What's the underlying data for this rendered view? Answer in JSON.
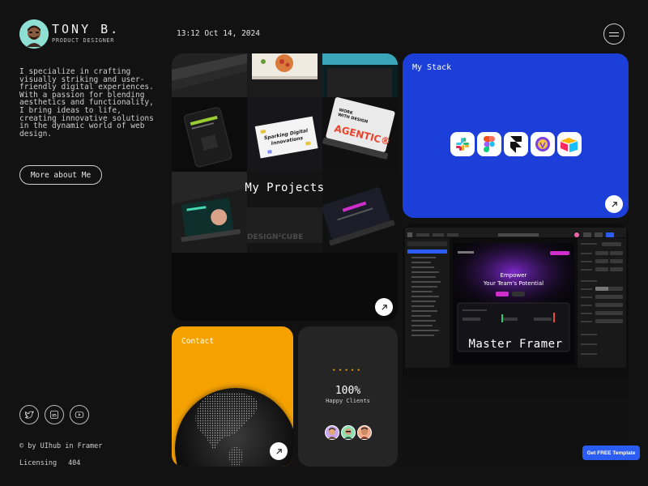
{
  "profile": {
    "name": "TONY B.",
    "role": "PRODUCT DESIGNER",
    "bio": "I specialize in crafting visually striking and user-friendly digital experiences. With a passion for blending aesthetics and functionality, I bring ideas to life, creating innovative solutions in the dynamic world of web design.",
    "about_button": "More about Me"
  },
  "socials": [
    {
      "icon": "twitter-icon"
    },
    {
      "icon": "linkedin-icon"
    },
    {
      "icon": "youtube-icon"
    }
  ],
  "footer": {
    "credit": "© by UIhub in Framer",
    "links": [
      "Licensing",
      "404"
    ]
  },
  "header": {
    "datetime": "13:12 Oct 14, 2024",
    "menu_icon": "hamburger-menu-icon"
  },
  "cards": {
    "projects": {
      "title": "My Projects",
      "thumb_texts": {
        "sparking": "Sparking Digital Innovations",
        "agentic": "AGENTIC®",
        "designcube": "DESIGN²CUBE",
        "work": "WORK WITH DESIGN CUBE"
      }
    },
    "stack": {
      "title": "My Stack",
      "tools": [
        "slack-icon",
        "figma-icon",
        "framer-icon",
        "notion-icon",
        "airtable-icon"
      ]
    },
    "master": {
      "title": "Master Framer",
      "hero_small": "Empower",
      "hero_big": "Your Team's Potential"
    },
    "contact": {
      "title": "Contact"
    },
    "clients": {
      "stars": "★★★★★",
      "percent": "100%",
      "label": "Happy Clients"
    }
  },
  "colors": {
    "background": "#121212",
    "stack_blue": "#1d3fd9",
    "contact_orange": "#f5a200",
    "star_yellow": "#f5b400",
    "cta_blue": "#2b5df5"
  },
  "cta": {
    "label": "Get FREE Template"
  }
}
